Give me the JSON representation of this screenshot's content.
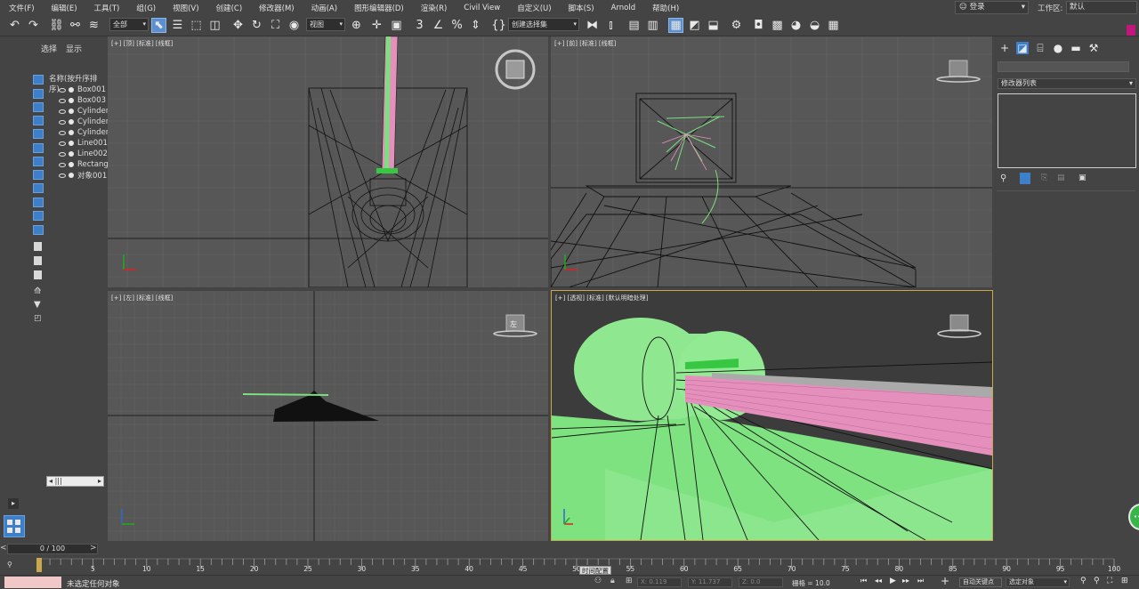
{
  "menu": [
    "文件(F)",
    "编辑(E)",
    "工具(T)",
    "组(G)",
    "视图(V)",
    "创建(C)",
    "修改器(M)",
    "动画(A)",
    "图形编辑器(D)",
    "渲染(R)",
    "Civil View",
    "自定义(U)",
    "脚本(S)",
    "Arnold",
    "帮助(H)"
  ],
  "login": "登录",
  "workspace": {
    "label": "工作区:",
    "value": "默认"
  },
  "toolbar": {
    "filter": "全部",
    "refcoord": "视图",
    "selection_set": "创建选择集"
  },
  "scene_explorer": {
    "tab_select": "选择",
    "tab_display": "显示",
    "header": "名称(按升序排序)",
    "items": [
      "Box001",
      "Box003",
      "Cylinder",
      "Cylinder",
      "Cylinder",
      "Line001",
      "Line002",
      "Rectang",
      "对象001"
    ],
    "scroll_label": "|||"
  },
  "viewports": {
    "top": "[+] [顶] [标准] [线框]",
    "front": "[+] [前] [标准] [线框]",
    "left": "[+] [左] [标准] [线框]",
    "perspective": "[+] [透视] [标准] [默认明暗处理]",
    "left_cube_label": "左"
  },
  "command_panel": {
    "modifier_list": "修改器列表"
  },
  "timeline": {
    "frame": "0 / 100",
    "ticks": [
      "5",
      "10",
      "15",
      "20",
      "25",
      "30",
      "35",
      "40",
      "45",
      "50",
      "55",
      "60",
      "65",
      "70",
      "75",
      "80",
      "85",
      "90",
      "95",
      "100"
    ],
    "tooltip": "时间配置"
  },
  "status": {
    "message": "未选定任何对象",
    "x": "X: 0.119",
    "y": "Y: 11.737",
    "z": "Z: 0.0",
    "grid": "栅格 = 10.0",
    "auto_key": "自动关键点",
    "selected": "选定对象"
  },
  "colors": {
    "accent": "#3d7fc9",
    "pink": "#e58fbd",
    "green": "#7be07e",
    "active_border": "#c9a84c"
  }
}
